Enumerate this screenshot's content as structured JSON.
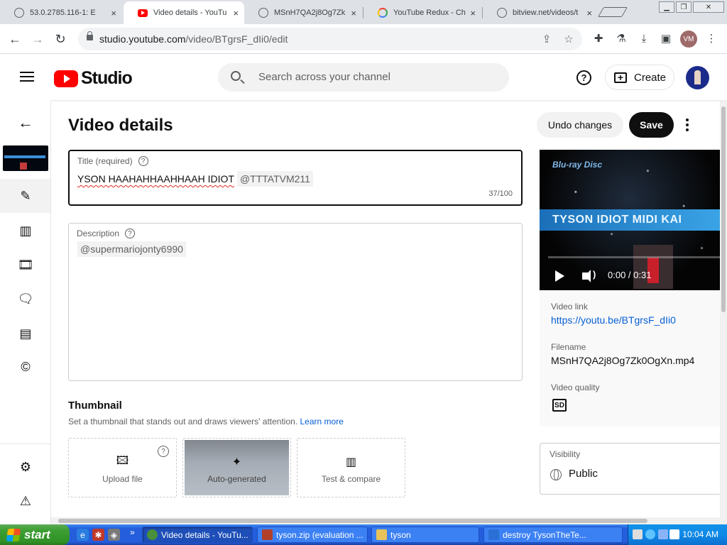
{
  "browser": {
    "tabs": [
      {
        "title": "53.0.2785.116-1: E",
        "icon": "globe-icon",
        "active": false
      },
      {
        "title": "Video details - YouTu",
        "icon": "youtube-icon",
        "active": true
      },
      {
        "title": "MSnH7QA2j8Og7Zk",
        "icon": "globe-icon",
        "active": false
      },
      {
        "title": "YouTube Redux - Ch",
        "icon": "redux-icon",
        "active": false
      },
      {
        "title": "bitview.net/videos/t",
        "icon": "globe-icon",
        "active": false
      }
    ],
    "close_glyph": "×",
    "url_host": "studio.youtube.com",
    "url_path": "/video/BTgrsF_dIi0/edit",
    "profile_initials": "VM"
  },
  "studio": {
    "logo_text": "Studio",
    "search_placeholder": "Search across your channel",
    "create_label": "Create",
    "page_title": "Video details",
    "undo_label": "Undo changes",
    "save_label": "Save",
    "title_field": {
      "label": "Title (required)",
      "value": "YSON HAAHAHHAAHHAAH IDIOT",
      "mention": "@TTTATVM211",
      "counter": "37/100"
    },
    "description_field": {
      "label": "Description",
      "mention": "@supermariojonty6990"
    },
    "thumbnail": {
      "heading": "Thumbnail",
      "subtext": "Set a thumbnail that stands out and draws viewers' attention.",
      "learn_more": "Learn more",
      "options": [
        {
          "label": "Upload file",
          "icon": "upload-image-icon"
        },
        {
          "label": "Auto-generated",
          "icon": "sparkle-icon"
        },
        {
          "label": "Test & compare",
          "icon": "bar-chart-icon"
        }
      ]
    },
    "player": {
      "logo": "Blu-ray Disc",
      "banner": "TYSON IDIOT MIDI KAI",
      "time": "0:00 / 0:31"
    },
    "details": {
      "video_link_label": "Video link",
      "video_link": "https://youtu.be/BTgrsF_dIi0",
      "filename_label": "Filename",
      "filename": "MSnH7QA2j8Og7Zk0OgXn.mp4",
      "quality_label": "Video quality",
      "quality_badge": "SD"
    },
    "visibility": {
      "label": "Visibility",
      "value": "Public"
    }
  },
  "taskbar": {
    "start_label": "start",
    "tasks": [
      {
        "label": "Video details - YouTu...",
        "active": true,
        "color": "#4a8f3a"
      },
      {
        "label": "tyson.zip (evaluation ...",
        "active": false,
        "color": "#b0402a"
      },
      {
        "label": "tyson",
        "active": false,
        "color": "#e8c35a"
      },
      {
        "label": "destroy TysonTheTe...",
        "active": false,
        "color": "#2a6fd6"
      }
    ],
    "clock": "10:04 AM",
    "chevron": "»"
  },
  "colors": {
    "youtube_red": "#ff0000",
    "link_blue": "#065fd4",
    "xp_blue": "#245edc",
    "xp_green": "#3c9e33"
  }
}
